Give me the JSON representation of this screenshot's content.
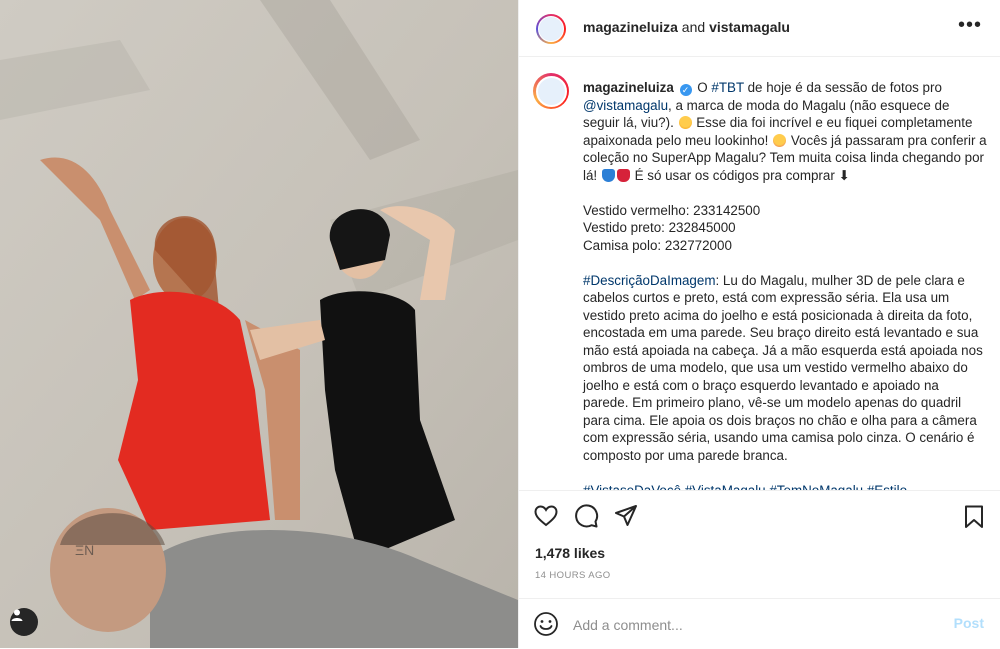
{
  "header": {
    "user1": "magazineluiza",
    "joiner": " and ",
    "user2": "vistamagalu",
    "more_icon": "ellipsis-icon"
  },
  "caption": {
    "username": "magazineluiza",
    "part1": " O ",
    "tag_tbt": "#TBT",
    "part2": " de hoje é da sessão de fotos pro ",
    "mention": "@vistamagalu",
    "part3": ", a marca de moda do Magalu (não esquece de seguir lá, viu?). ",
    "part4": " Esse dia foi incrível e eu fiquei completamente apaixonada pelo meu lookinho! ",
    "part5": " Vocês já passaram pra conferir a coleção no SuperApp Magalu? Tem muita coisa linda chegando por lá! ",
    "part6": " É só usar os códigos pra comprar ⬇",
    "code1": "Vestido vermelho: 233142500",
    "code2": "Vestido preto: 232845000",
    "code3": "Camisa polo: 232772000",
    "desc_tag": "#DescriçãoDaImagem",
    "desc_text": ": Lu do Magalu, mulher 3D de pele clara e cabelos curtos e preto, está com expressão séria. Ela usa um vestido preto acima do joelho e está posicionada à direita da foto, encostada em uma parede. Seu braço direito está levantado e sua mão está apoiada na cabeça. Já a mão esquerda está apoiada nos ombros de uma modelo, que usa um vestido vermelho abaixo do joelho e está com o braço esquerdo levantado e apoiado na parede. Em primeiro plano, vê-se um modelo apenas do quadril para cima. Ele apoia os dois braços no chão e olha para a câmera com expressão séria, usando uma camisa polo cinza. O cenário é composto por uma parede branca.",
    "hashtags": "#VistaseDaVocê #VistaMagalu #TemNoMagalu #Estilo"
  },
  "actions": {
    "likes": "1,478 likes",
    "time": "14 HOURS AGO"
  },
  "comment": {
    "placeholder": "Add a comment...",
    "post_label": "Post"
  },
  "colors": {
    "link": "#00376b",
    "verified": "#3897f0",
    "post_disabled": "#b2dffc",
    "muted": "#8e8e8e"
  }
}
